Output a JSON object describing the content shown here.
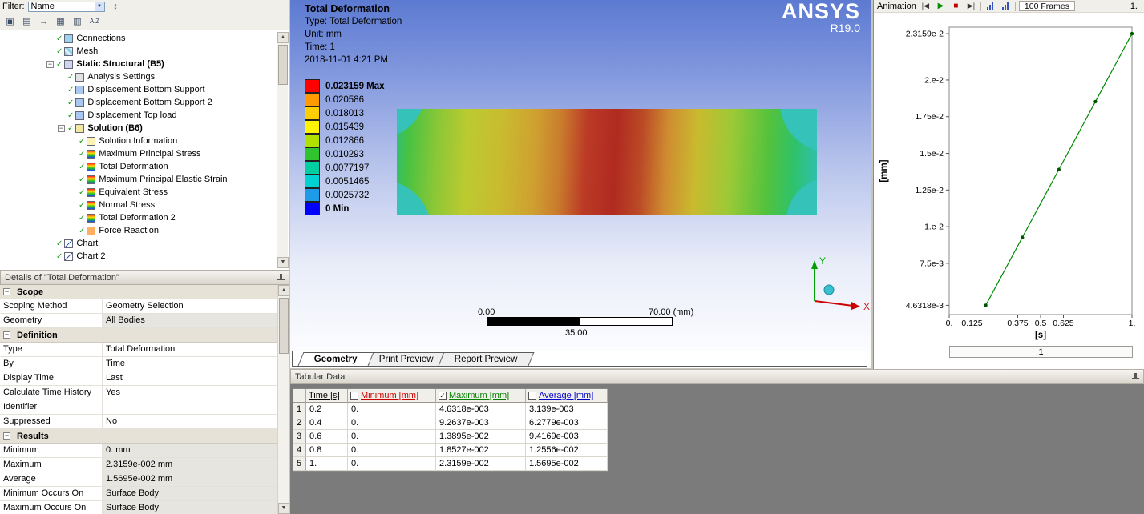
{
  "outline": {
    "filter_label": "Filter:",
    "filter_value": "Name",
    "filter_bar_icon_glyph": "↕",
    "toolbar_icons": [
      {
        "name": "model-view-icon",
        "glyph": "▣"
      },
      {
        "name": "worksheet-icon",
        "glyph": "▤"
      },
      {
        "name": "go-to-icon",
        "glyph": "→"
      },
      {
        "name": "box-select-icon",
        "glyph": "▦"
      },
      {
        "name": "tags-icon",
        "glyph": "▥"
      },
      {
        "name": "sort-az-icon",
        "glyph": "A↓Z"
      }
    ],
    "tree": [
      {
        "label": "Connections",
        "level": 0,
        "icon": "connections"
      },
      {
        "label": "Mesh",
        "level": 0,
        "icon": "mesh"
      },
      {
        "label": "Static Structural (B5)",
        "level": 0,
        "icon": "static-structural",
        "bold": true,
        "expander": "minus"
      },
      {
        "label": "Analysis Settings",
        "level": 1,
        "icon": "analysis-settings"
      },
      {
        "label": "Displacement Bottom Support",
        "level": 1,
        "icon": "displacement"
      },
      {
        "label": "Displacement Bottom Support 2",
        "level": 1,
        "icon": "displacement"
      },
      {
        "label": "Displacement Top load",
        "level": 1,
        "icon": "displacement"
      },
      {
        "label": "Solution (B6)",
        "level": 1,
        "icon": "solution",
        "bold": true,
        "expander": "minus"
      },
      {
        "label": "Solution Information",
        "level": 2,
        "icon": "solution-info"
      },
      {
        "label": "Maximum Principal Stress",
        "level": 2,
        "icon": "result"
      },
      {
        "label": "Total Deformation",
        "level": 2,
        "icon": "result"
      },
      {
        "label": "Maximum Principal Elastic Strain",
        "level": 2,
        "icon": "result"
      },
      {
        "label": "Equivalent Stress",
        "level": 2,
        "icon": "result"
      },
      {
        "label": "Normal Stress",
        "level": 2,
        "icon": "result"
      },
      {
        "label": "Total Deformation 2",
        "level": 2,
        "icon": "result"
      },
      {
        "label": "Force Reaction",
        "level": 2,
        "icon": "force-reaction"
      },
      {
        "label": "Chart",
        "level": 0,
        "icon": "chart"
      },
      {
        "label": "Chart 2",
        "level": 0,
        "icon": "chart"
      }
    ]
  },
  "details": {
    "title": "Details of \"Total Deformation\"",
    "rows": [
      {
        "type": "category",
        "label": "Scope"
      },
      {
        "type": "row",
        "label": "Scoping Method",
        "value": "Geometry Selection"
      },
      {
        "type": "row",
        "label": "Geometry",
        "value": "All Bodies",
        "shaded": true
      },
      {
        "type": "category",
        "label": "Definition"
      },
      {
        "type": "row",
        "label": "Type",
        "value": "Total Deformation"
      },
      {
        "type": "row",
        "label": "By",
        "value": "Time"
      },
      {
        "type": "row",
        "label": "Display Time",
        "value": "Last"
      },
      {
        "type": "row",
        "label": "Calculate Time History",
        "value": "Yes"
      },
      {
        "type": "row",
        "label": "Identifier",
        "value": ""
      },
      {
        "type": "row",
        "label": "Suppressed",
        "value": "No"
      },
      {
        "type": "category",
        "label": "Results"
      },
      {
        "type": "row",
        "label": "Minimum",
        "value": "0. mm",
        "shaded": true
      },
      {
        "type": "row",
        "label": "Maximum",
        "value": "2.3159e-002 mm",
        "shaded": true
      },
      {
        "type": "row",
        "label": "Average",
        "value": "1.5695e-002 mm",
        "shaded": true
      },
      {
        "type": "row",
        "label": "Minimum Occurs On",
        "value": "Surface Body",
        "shaded": true
      },
      {
        "type": "row",
        "label": "Maximum Occurs On",
        "value": "Surface Body",
        "shaded": true
      }
    ]
  },
  "viewport": {
    "result_header": {
      "title": "Total Deformation",
      "type": "Type: Total Deformation",
      "unit": "Unit: mm",
      "time": "Time: 1",
      "date": "2018-11-01 4:21 PM"
    },
    "logo_line1": "ANSYS",
    "logo_line2": "R19.0",
    "legend": [
      {
        "label": "0.023159 Max",
        "color": "#ff0000",
        "bold": true
      },
      {
        "label": "0.020586",
        "color": "#ff9b00"
      },
      {
        "label": "0.018013",
        "color": "#ffce00"
      },
      {
        "label": "0.015439",
        "color": "#fff500"
      },
      {
        "label": "0.012866",
        "color": "#b0e000"
      },
      {
        "label": "0.010293",
        "color": "#2fc42f"
      },
      {
        "label": "0.0077197",
        "color": "#00cf9f"
      },
      {
        "label": "0.0051465",
        "color": "#00d2d2"
      },
      {
        "label": "0.0025732",
        "color": "#1e9be6"
      },
      {
        "label": "0 Min",
        "color": "#0000ff",
        "bold": true
      }
    ],
    "ruler": {
      "left": "0.00",
      "right": "70.00 (mm)",
      "mid": "35.00"
    },
    "triad": {
      "x_label": "X",
      "y_label": "Y"
    },
    "tabs": [
      {
        "label": "Geometry",
        "active": true
      },
      {
        "label": "Print Preview",
        "active": false
      },
      {
        "label": "Report Preview",
        "active": false
      }
    ]
  },
  "animation_toolbar": {
    "title": "Animation",
    "icons": {
      "previous": "|◀",
      "play": "▶",
      "stop": "■",
      "next": "▶|"
    },
    "frames": "100 Frames"
  },
  "graph": {
    "top_right_label": "1.",
    "time_value": "1",
    "chart_data": {
      "type": "line",
      "title": "",
      "xlabel": "[s]",
      "ylabel": "[mm]",
      "xlim": [
        0,
        1
      ],
      "ylim": [
        0.004,
        0.0236
      ],
      "series": [
        {
          "name": "Maximum [mm]",
          "color": "#008a00",
          "x": [
            0.2,
            0.4,
            0.6,
            0.8,
            1.0
          ],
          "y": [
            0.0046318,
            0.0092637,
            0.013895,
            0.018527,
            0.023159
          ]
        }
      ],
      "xticks": [
        {
          "v": 0,
          "label": "0."
        },
        {
          "v": 0.125,
          "label": "0.125"
        },
        {
          "v": 0.375,
          "label": "0.375"
        },
        {
          "v": 0.5,
          "label": "0.5"
        },
        {
          "v": 0.625,
          "label": "0.625"
        },
        {
          "v": 1,
          "label": "1."
        }
      ],
      "yticks": [
        {
          "v": 0.023159,
          "label": "2.3159e-2"
        },
        {
          "v": 0.02,
          "label": "2.e-2"
        },
        {
          "v": 0.0175,
          "label": "1.75e-2"
        },
        {
          "v": 0.015,
          "label": "1.5e-2"
        },
        {
          "v": 0.0125,
          "label": "1.25e-2"
        },
        {
          "v": 0.01,
          "label": "1.e-2"
        },
        {
          "v": 0.0075,
          "label": "7.5e-3"
        },
        {
          "v": 0.0046318,
          "label": "4.6318e-3"
        }
      ]
    }
  },
  "tabular": {
    "title": "Tabular Data",
    "columns": [
      {
        "label": "",
        "checkbox": false,
        "color": "#000000"
      },
      {
        "label": "Time [s]",
        "checkbox": false,
        "color": "#000000"
      },
      {
        "label": "Minimum [mm]",
        "checkbox": true,
        "checked": false,
        "color": "#cc0000"
      },
      {
        "label": "Maximum [mm]",
        "checkbox": true,
        "checked": true,
        "color": "#008000"
      },
      {
        "label": "Average [mm]",
        "checkbox": true,
        "checked": false,
        "color": "#0000cc"
      }
    ],
    "rows": [
      [
        "1",
        "0.2",
        "0.",
        "4.6318e-003",
        "3.139e-003"
      ],
      [
        "2",
        "0.4",
        "0.",
        "9.2637e-003",
        "6.2779e-003"
      ],
      [
        "3",
        "0.6",
        "0.",
        "1.3895e-002",
        "9.4169e-003"
      ],
      [
        "4",
        "0.8",
        "0.",
        "1.8527e-002",
        "1.2556e-002"
      ],
      [
        "5",
        "1.",
        "0.",
        "2.3159e-002",
        "1.5695e-002"
      ]
    ]
  }
}
